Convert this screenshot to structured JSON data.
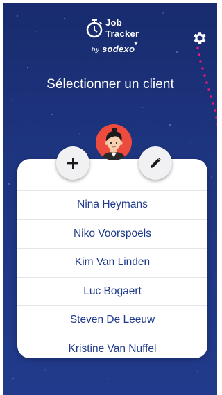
{
  "app": {
    "logo_line1": "Job",
    "logo_line2": "Tracker",
    "logo_by": "by",
    "logo_brand": "sodexo"
  },
  "header": {
    "settings_icon": "gear-icon"
  },
  "page": {
    "title": "Sélectionner un client"
  },
  "actions": {
    "add_icon": "plus-icon",
    "edit_icon": "pencil-icon",
    "avatar_icon": "user-avatar"
  },
  "clients": [
    "Nina Heymans",
    "Niko Voorspoels",
    "Kim Van Linden",
    "Luc Bogaert",
    "Steven De Leeuw",
    "Kristine Van Nuffel"
  ],
  "colors": {
    "background": "#1e3580",
    "client_text": "#1f3a8a",
    "avatar_bg": "#ec4b3d",
    "accent_dots": "#e6197d"
  }
}
